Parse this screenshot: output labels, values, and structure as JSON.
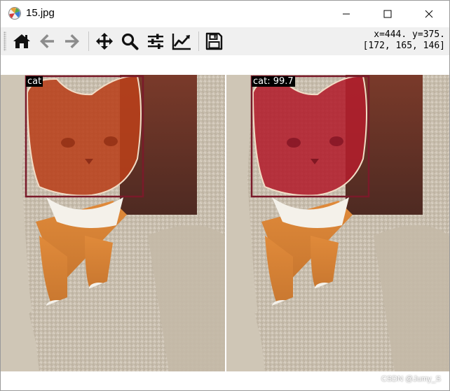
{
  "window": {
    "title": "15.jpg"
  },
  "toolbar": {
    "buttons": [
      {
        "name": "home-icon"
      },
      {
        "name": "back-arrow-icon"
      },
      {
        "name": "forward-arrow-icon"
      },
      {
        "name": "pan-move-icon"
      },
      {
        "name": "zoom-magnifier-icon"
      },
      {
        "name": "subplots-sliders-icon"
      },
      {
        "name": "edit-axes-chart-icon"
      },
      {
        "name": "save-floppy-icon"
      }
    ],
    "coords_line1": "x=444. y=375.",
    "coords_line2": "[172, 165, 146]"
  },
  "panels": {
    "left_label": "cat",
    "right_label": "cat: 99.7"
  },
  "colors": {
    "left_mask": "#b8401a",
    "right_mask": "#b21e2c",
    "box_outline": "#7a1a2a",
    "fur": "#d4cbbd"
  },
  "watermark": "CSDN @Jumy_S"
}
